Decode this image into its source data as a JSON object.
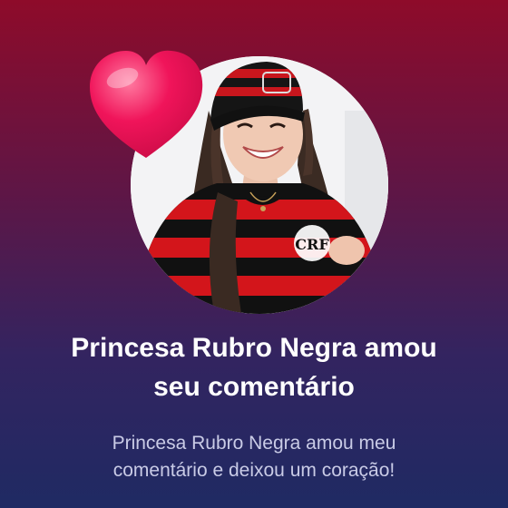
{
  "notification": {
    "title_line1": "Princesa Rubro Negra amou",
    "title_line2": "seu comentário",
    "message_line1": "Princesa Rubro Negra amou meu",
    "message_line2": "comentário e deixou um coração!"
  },
  "avatar": {
    "shirt_crest": "CRF"
  },
  "icons": {
    "heart": "heart-icon"
  },
  "colors": {
    "background_top": "#8e0b2a",
    "background_bottom": "#1f2a63",
    "heart": "#f0145a",
    "title_text": "#ffffff",
    "message_text": "#c9cbe6"
  }
}
